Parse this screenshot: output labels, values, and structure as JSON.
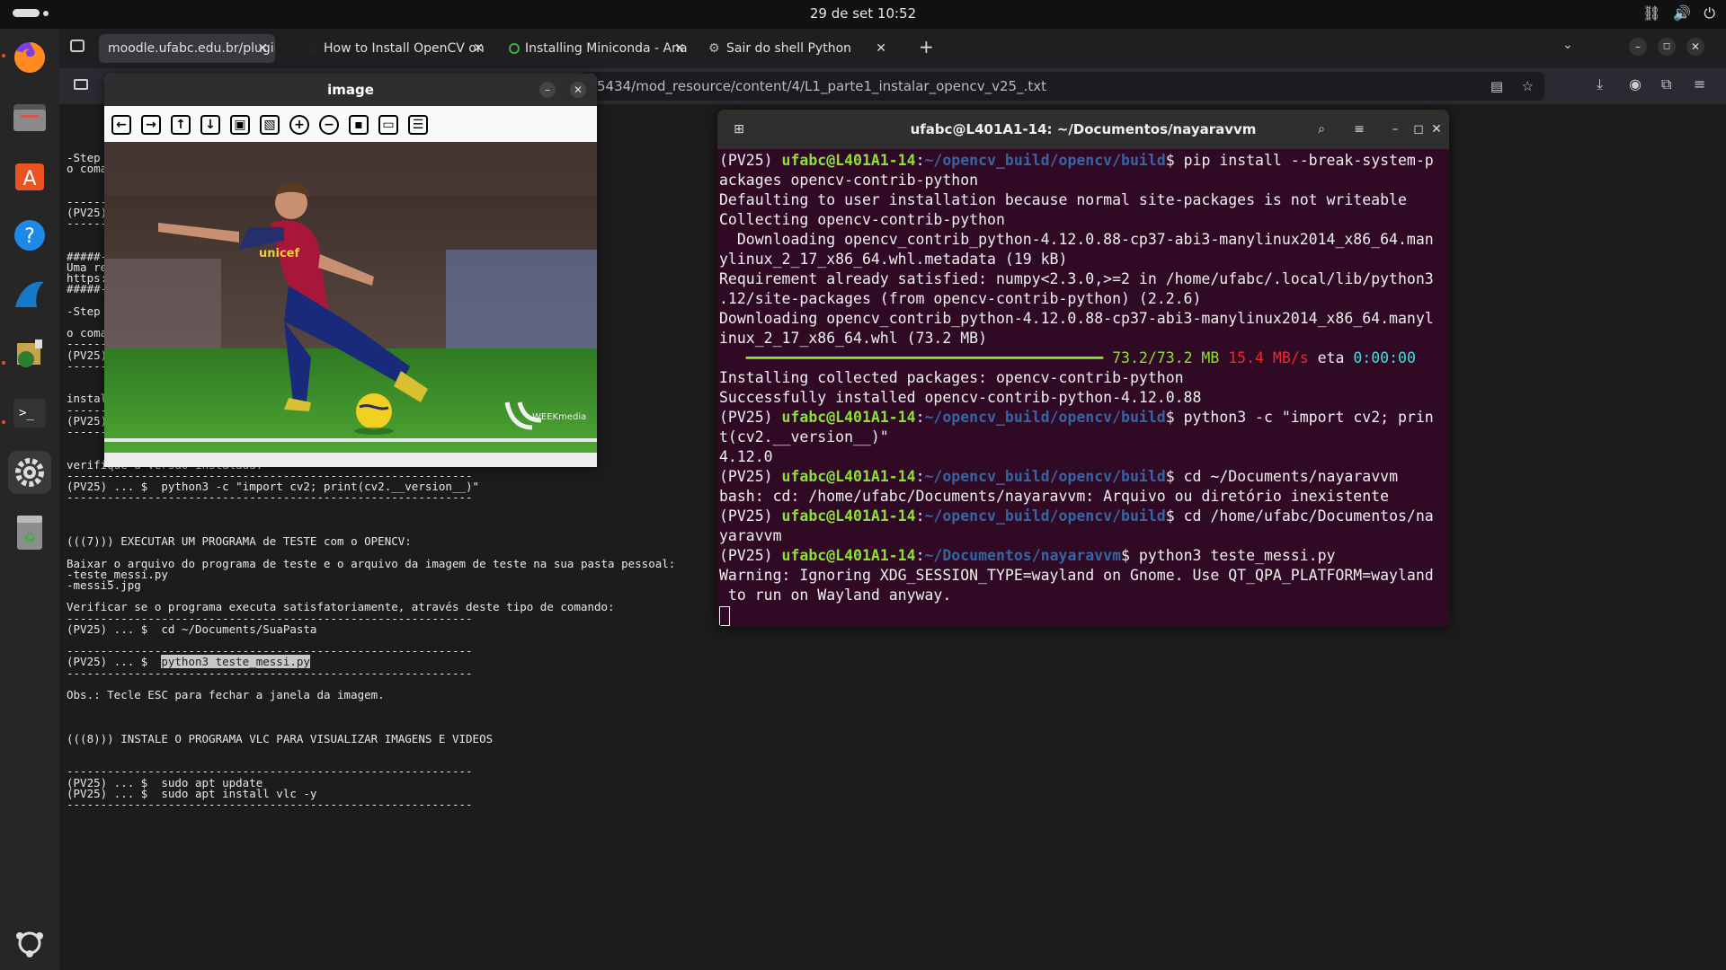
{
  "topbar": {
    "clock": "29 de set  10:52"
  },
  "browser": {
    "tabs": [
      {
        "label": "moodle.ufabc.edu.br/plugin",
        "active": true
      },
      {
        "label": "How to Install OpenCV on",
        "active": false
      },
      {
        "label": "Installing Miniconda - Ana",
        "active": false
      },
      {
        "label": "Sair do shell Python",
        "active": false
      }
    ],
    "url": "5434/mod_resource/content/4/L1_parte1_instalar_opencv_v25_.txt"
  },
  "page_text": {
    "before": "-Step\no coma\n\n\n--------\n(PV25)\n--------\n\n\n#####-\nUma re\nhttps:\n#####-\n\n-Step\n\no coma\n--------\n(PV25)\n--------\n\n\ninstal\n--------\n(PV25) ... $  pip install opencv-contrib-python\n------------------------------------------------------------\n\n\nverifique a versão instalada:\n------------------------------------------------------------\n(PV25) ... $  python3 -c \"import cv2; print(cv2.__version__)\"\n------------------------------------------------------------\n\n\n\n(((7))) EXECUTAR UM PROGRAMA de TESTE com o OPENCV:\n\nBaixar o arquivo do programa de teste e o arquivo da imagem de teste na sua pasta pessoal:\n-teste_messi.py\n-messi5.jpg\n\nVerificar se o programa executa satisfatoriamente, através deste tipo de comando:\n------------------------------------------------------------\n(PV25) ... $  cd ~/Documents/SuaPasta\n\n------------------------------------------------------------\n(PV25) ... $  ",
    "highlight": "python3 teste_messi.py",
    "after": "\n------------------------------------------------------------\n\nObs.: Tecle ESC para fechar a janela da imagem.\n\n\n\n(((8))) INSTALE O PROGRAMA VLC PARA VISUALIZAR IMAGENS E VIDEOS\n\n\n------------------------------------------------------------\n(PV25) ... $  sudo apt update\n(PV25) ... $  sudo apt install vlc -y\n------------------------------------------------------------"
  },
  "image_window": {
    "title": "image",
    "toolbar_icons": [
      "arrow-left-icon",
      "arrow-right-icon",
      "arrow-up-icon",
      "arrow-down-icon",
      "image-icon",
      "image-settings-icon",
      "zoom-in-icon",
      "zoom-out-icon",
      "save-icon",
      "copy-icon",
      "properties-icon"
    ]
  },
  "photo": {
    "shirt_text": "unicef",
    "watermark": "WEEKmedia"
  },
  "terminal": {
    "title": "ufabc@L401A1-14: ~/Documentos/nayaravvm",
    "user_host": "ufabc@L401A1-14",
    "path_build": "~/opencv_build/opencv/build",
    "path_docs": "~/Documentos/nayaravvm",
    "env": "(PV25)",
    "cmd1a": "$ pip install --break-system-p",
    "cmd1b": "ackages opencv-contrib-python",
    "out1": "Defaulting to user installation because normal site-packages is not writeable",
    "out2": "Collecting opencv-contrib-python",
    "out3": "  Downloading opencv_contrib_python-4.12.0.88-cp37-abi3-manylinux2014_x86_64.man",
    "out4": "ylinux_2_17_x86_64.whl.metadata (19 kB)",
    "out5": "Requirement already satisfied: numpy<2.3.0,>=2 in /home/ufabc/.local/lib/python3",
    "out6": ".12/site-packages (from opencv-contrib-python) (2.2.6)",
    "out7": "Downloading opencv_contrib_python-4.12.0.88-cp37-abi3-manylinux2014_x86_64.manyl",
    "out8": "inux_2_17_x86_64.whl (73.2 MB)",
    "progress_bar": "   ━━━━━━━━━━━━━━━━━━━━━━━━━━━━━━━━━━━━━━━━",
    "progress_size": "73.2/73.2 MB",
    "progress_speed": "15.4 MB/s",
    "progress_eta_label": "eta",
    "progress_eta": "0:00:00",
    "progress_fraction": 1.0,
    "out9": "Installing collected packages: opencv-contrib-python",
    "out10": "Successfully installed opencv-contrib-python-4.12.0.88",
    "cmd2a": "$ python3 -c \"import cv2; prin",
    "cmd2b": "t(cv2.__version__)\"",
    "out11": "4.12.0",
    "cmd3": "$ cd ~/Documents/nayaravvm",
    "out12": "bash: cd: /home/ufabc/Documents/nayaravvm: Arquivo ou diretório inexistente",
    "cmd4a": "$ cd /home/ufabc/Documentos/na",
    "cmd4b": "yaravvm",
    "cmd5": "$ python3 teste_messi.py",
    "out13": "Warning: Ignoring XDG_SESSION_TYPE=wayland on Gnome. Use QT_QPA_PLATFORM=wayland",
    "out14": " to run on Wayland anyway."
  }
}
